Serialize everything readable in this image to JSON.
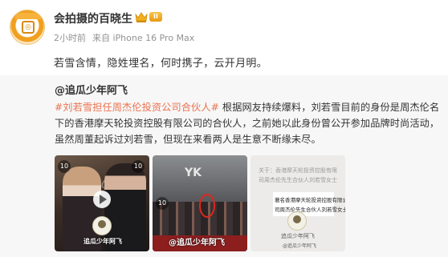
{
  "post": {
    "author": "会拍摄的百晓生",
    "level_badge": "II",
    "time": "2小时前",
    "source": "来自 iPhone 16 Pro Max",
    "text": "若雪含情，隐姓埋名，何时携子，云开月明。"
  },
  "repost": {
    "author": "@追瓜少年阿飞",
    "hashtag": "#刘若雪担任周杰伦投资公司合伙人#",
    "body": "根据网友持续爆料，刘若雪目前的身份是周杰伦名下的香港摩天轮投资控股有限公司的合伙人，之前她以此身份曾公开参加品牌时尚活动，虽然周董起诉过刘若雪，但现在来看两人是生意不断缘未尽。",
    "photos": [
      {
        "duration_badge": "10",
        "watermark": "追瓜少年阿飞",
        "icon": "play-icon"
      },
      {
        "duration_badge": "10",
        "watermark": "@追瓜少年阿飞",
        "logo_text": "YK"
      },
      {
        "doc_line_1": "著名香港摩天轮投资控股有限公司",
        "doc_line_2": "司周杰伦先生合伙人刘若雪女士",
        "doc_faint_1": "关于：香港摩天轮投资控股有限",
        "doc_faint_2": "司周杰伦先生合伙人刘若雪女士",
        "watermark": "追瓜少年阿飞",
        "watermark_2": "@追瓜少年阿飞"
      }
    ]
  },
  "colors": {
    "hashtag": "#eb7350",
    "meta": "#939393",
    "repost_bg": "#f7f7f7"
  }
}
